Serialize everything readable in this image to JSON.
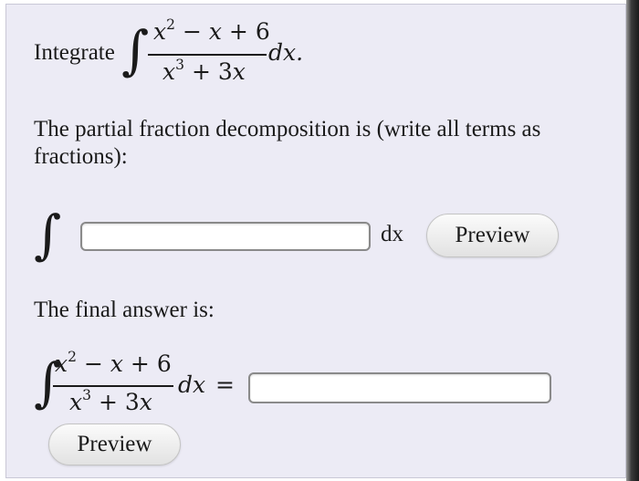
{
  "question": {
    "intro_label": "Integrate",
    "integral_sign": "∫",
    "numerator": {
      "base1": "x",
      "exp1": "2",
      "op1": "−",
      "base2": "x",
      "op2": "+",
      "const": "6"
    },
    "denominator": {
      "base1": "x",
      "exp1": "3",
      "op1": "+",
      "coef": "3",
      "base2": "x"
    },
    "differential": "dx."
  },
  "part1": {
    "prompt": "The partial fraction decomposition is (write all terms as fractions):",
    "integral_sign": "∫",
    "answer_value": "",
    "dx_label": "dx",
    "preview_label": "Preview"
  },
  "part2": {
    "prompt": "The final answer is:",
    "integral_sign": "∫",
    "numerator": {
      "base1": "x",
      "exp1": "2",
      "op1": "−",
      "base2": "x",
      "op2": "+",
      "const": "6"
    },
    "denominator": {
      "base1": "x",
      "exp1": "3",
      "op1": "+",
      "coef": "3",
      "base2": "x"
    },
    "differential": "dx",
    "equals": "=",
    "answer_value": "",
    "preview_label": "Preview"
  }
}
